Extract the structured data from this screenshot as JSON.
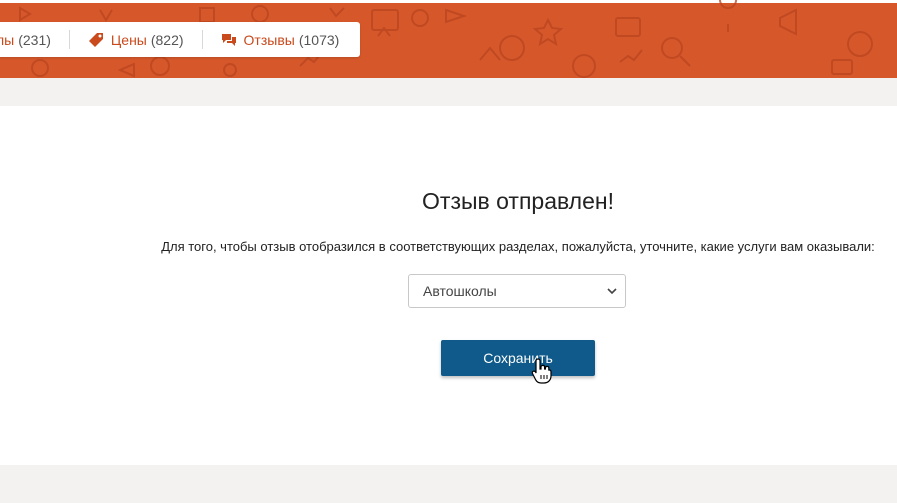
{
  "header": {
    "tabs": [
      {
        "label": "лы",
        "count": "(231)"
      },
      {
        "label": "Цены",
        "count": "(822)"
      },
      {
        "label": "Отзывы",
        "count": "(1073)"
      }
    ],
    "colors": {
      "band": "#d6572a",
      "accent": "#c94a1c"
    }
  },
  "main": {
    "title": "Отзыв отправлен!",
    "hint": "Для того, чтобы отзыв отобразился в соответствующих разделах, пожалуйста, уточните, какие услуги вам оказывали:",
    "select": {
      "value": "Автошколы"
    },
    "save_label": "Сохранить",
    "colors": {
      "button": "#0f5a8a"
    }
  }
}
